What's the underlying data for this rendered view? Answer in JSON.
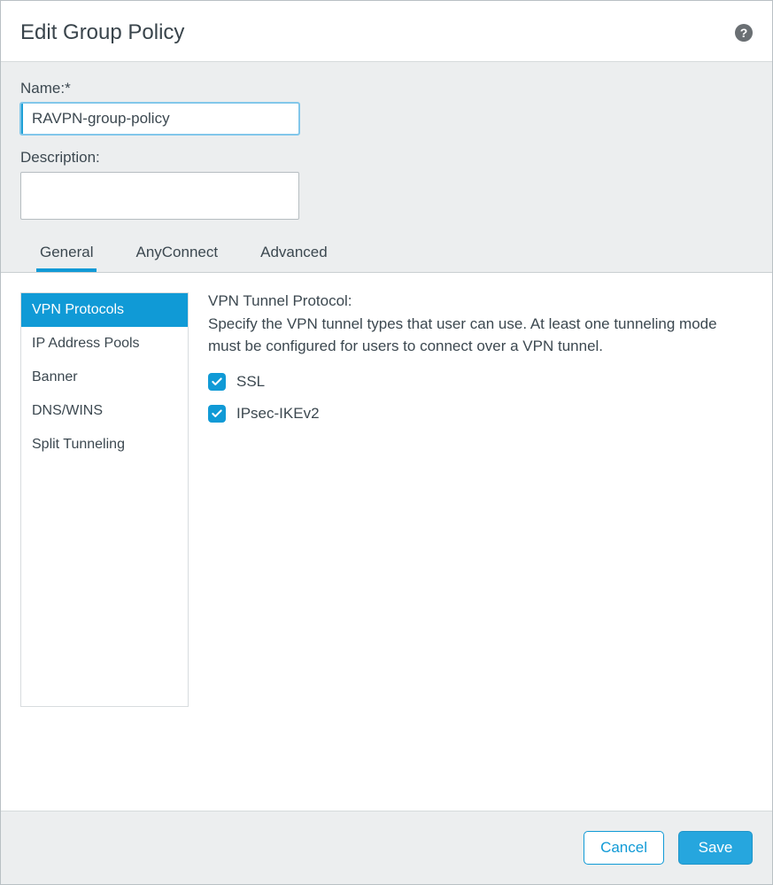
{
  "dialog": {
    "title": "Edit Group Policy"
  },
  "form": {
    "name_label": "Name:*",
    "name_value": "RAVPN-group-policy",
    "description_label": "Description:",
    "description_value": ""
  },
  "tabs": {
    "general": "General",
    "anyconnect": "AnyConnect",
    "advanced": "Advanced"
  },
  "side_nav": {
    "vpn_protocols": "VPN Protocols",
    "ip_address_pools": "IP Address Pools",
    "banner": "Banner",
    "dns_wins": "DNS/WINS",
    "split_tunneling": "Split Tunneling"
  },
  "content": {
    "heading": "VPN Tunnel Protocol:",
    "desc": "Specify the VPN tunnel types that user can use. At least one tunneling mode must be configured for users to connect over a VPN tunnel.",
    "ssl_label": "SSL",
    "ipsec_label": "IPsec-IKEv2"
  },
  "footer": {
    "cancel": "Cancel",
    "save": "Save"
  }
}
